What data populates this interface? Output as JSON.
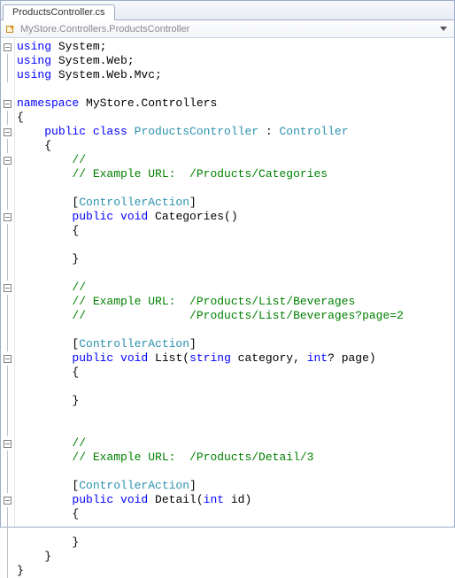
{
  "tab": {
    "label": "ProductsController.cs"
  },
  "breadcrumb": {
    "text": "MyStore.Controllers.ProductsController"
  },
  "code": {
    "l1": {
      "a": "using ",
      "b": "System;"
    },
    "l2": {
      "a": "using ",
      "b": "System.Web;"
    },
    "l3": {
      "a": "using ",
      "b": "System.Web.Mvc;"
    },
    "l4": "",
    "l5": {
      "a": "namespace ",
      "b": "MyStore.Controllers"
    },
    "l6": "{",
    "l7": {
      "a": "    ",
      "b": "public ",
      "c": "class ",
      "d": "ProductsController",
      "e": " : ",
      "f": "Controller"
    },
    "l8": "    {",
    "l9": {
      "a": "        ",
      "b": "//"
    },
    "l10": {
      "a": "        ",
      "b": "// Example URL:  /Products/Categories"
    },
    "l11": "",
    "l12": {
      "a": "        [",
      "b": "ControllerAction",
      "c": "]"
    },
    "l13": {
      "a": "        ",
      "b": "public ",
      "c": "void ",
      "d": "Categories()"
    },
    "l14": "        {",
    "l15": "",
    "l16": "        }",
    "l17": "",
    "l18": {
      "a": "        ",
      "b": "//"
    },
    "l19": {
      "a": "        ",
      "b": "// Example URL:  /Products/List/Beverages"
    },
    "l20": {
      "a": "        ",
      "b": "//               /Products/List/Beverages?page=2"
    },
    "l21": "",
    "l22": {
      "a": "        [",
      "b": "ControllerAction",
      "c": "]"
    },
    "l23": {
      "a": "        ",
      "b": "public ",
      "c": "void ",
      "d": "List(",
      "e": "string ",
      "f": "category, ",
      "g": "int",
      "h": "? page)"
    },
    "l24": "        {",
    "l25": "",
    "l26": "        }",
    "l27": "",
    "l28": "",
    "l29": {
      "a": "        ",
      "b": "//"
    },
    "l30": {
      "a": "        ",
      "b": "// Example URL:  /Products/Detail/3"
    },
    "l31": "",
    "l32": {
      "a": "        [",
      "b": "ControllerAction",
      "c": "]"
    },
    "l33": {
      "a": "        ",
      "b": "public ",
      "c": "void ",
      "d": "Detail(",
      "e": "int ",
      "f": "id)"
    },
    "l34": "        {",
    "l35": "",
    "l36": "        }",
    "l37": "    }",
    "l38": "}"
  }
}
